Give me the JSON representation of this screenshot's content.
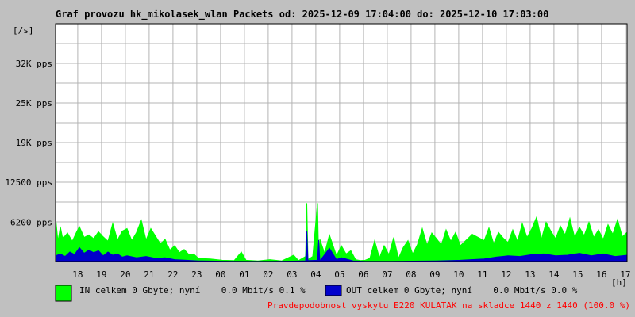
{
  "colors": {
    "background": "#c0c0c0",
    "plot_background": "#ffffff",
    "grid": "#b4b4b4",
    "in_series": "#00ff00",
    "out_series": "#0000cc",
    "info_text": "#ff0000"
  },
  "legend": {
    "in_text": "IN celkem 0 Gbyte; nyní    0.0 Mbit/s 0.1 %",
    "out_text": "OUT celkem 0 Gbyte; nyní    0.0 Mbit/s 0.0 %"
  },
  "footer": {
    "info": "Pravdepodobnost vyskytu E220 KULATAK na skladce 1440 z 1440 (100.0 %)"
  },
  "chart_data": {
    "type": "area",
    "title": "Graf provozu hk_mikolasek_wlan Packets od: 2025-12-09 17:04:00 do: 2025-12-10 17:03:00",
    "ylabel": "[/s]",
    "xlabel": "[h]",
    "grid": true,
    "ylim": [
      0,
      37500
    ],
    "xlim": [
      0,
      24
    ],
    "y_ticks": [
      {
        "value": 6200,
        "label": "6200 pps"
      },
      {
        "value": 12500,
        "label": "12500 pps"
      },
      {
        "value": 18750,
        "label": "19K pps"
      },
      {
        "value": 25000,
        "label": "25K pps"
      },
      {
        "value": 31250,
        "label": "32K pps"
      }
    ],
    "x_ticks": [
      "18",
      "19",
      "20",
      "21",
      "22",
      "23",
      "00",
      "01",
      "02",
      "03",
      "04",
      "05",
      "06",
      "07",
      "08",
      "09",
      "10",
      "11",
      "12",
      "13",
      "14",
      "15",
      "16",
      "17"
    ],
    "x_start_hour": 17.07,
    "series": [
      {
        "name": "IN",
        "x": [
          0.0,
          0.1,
          0.2,
          0.3,
          0.5,
          0.7,
          0.9,
          1.0,
          1.2,
          1.4,
          1.6,
          1.8,
          2.0,
          2.2,
          2.4,
          2.6,
          2.8,
          3.0,
          3.2,
          3.4,
          3.6,
          3.8,
          4.0,
          4.2,
          4.4,
          4.6,
          4.8,
          5.0,
          5.2,
          5.4,
          5.6,
          5.8,
          6.0,
          6.5,
          7.0,
          7.5,
          7.8,
          8.0,
          8.5,
          9.0,
          9.5,
          10.0,
          10.2,
          10.5,
          10.55,
          10.6,
          10.8,
          11.0,
          11.05,
          11.1,
          11.3,
          11.5,
          11.8,
          12.0,
          12.2,
          12.4,
          12.6,
          12.8,
          13.0,
          13.2,
          13.4,
          13.6,
          13.8,
          14.0,
          14.2,
          14.4,
          14.6,
          14.8,
          15.0,
          15.2,
          15.4,
          15.6,
          15.8,
          16.0,
          16.2,
          16.4,
          16.6,
          16.8,
          17.0,
          17.5,
          18.0,
          18.2,
          18.4,
          18.6,
          18.8,
          19.0,
          19.2,
          19.4,
          19.6,
          19.8,
          20.0,
          20.2,
          20.4,
          20.6,
          20.8,
          21.0,
          21.2,
          21.4,
          21.6,
          21.8,
          22.0,
          22.2,
          22.4,
          22.6,
          22.8,
          23.0,
          23.2,
          23.4,
          23.6,
          23.8,
          24.0
        ],
        "values": [
          7000,
          3200,
          5500,
          3600,
          4500,
          3200,
          4800,
          5500,
          3800,
          4200,
          3600,
          4700,
          3900,
          3200,
          6000,
          3400,
          4800,
          5200,
          3300,
          4600,
          6500,
          3400,
          5200,
          4000,
          2800,
          3500,
          1800,
          2500,
          1400,
          1900,
          1100,
          1200,
          500,
          400,
          200,
          150,
          1500,
          200,
          100,
          300,
          100,
          1000,
          150,
          800,
          9200,
          300,
          800,
          9200,
          300,
          3500,
          1300,
          4200,
          900,
          2500,
          1200,
          1700,
          300,
          150,
          200,
          500,
          3300,
          600,
          2500,
          1100,
          3800,
          500,
          2200,
          3300,
          1200,
          2700,
          5200,
          2600,
          4500,
          3600,
          2600,
          5000,
          3200,
          4600,
          2500,
          4300,
          3300,
          5300,
          2800,
          4600,
          3700,
          3000,
          5000,
          3200,
          6000,
          3800,
          5200,
          7000,
          3500,
          6200,
          4800,
          3600,
          5600,
          4200,
          6800,
          3800,
          5400,
          4100,
          6200,
          3800,
          5000,
          3500,
          5800,
          4300,
          6600,
          3900,
          4600
        ]
      },
      {
        "name": "OUT",
        "x": [
          0.0,
          0.2,
          0.4,
          0.6,
          0.8,
          1.0,
          1.2,
          1.4,
          1.6,
          1.8,
          2.0,
          2.2,
          2.4,
          2.6,
          2.8,
          3.0,
          3.4,
          3.8,
          4.2,
          4.6,
          5.0,
          5.5,
          6.0,
          7.0,
          8.0,
          9.0,
          10.0,
          10.5,
          10.55,
          10.6,
          11.0,
          11.05,
          11.1,
          11.5,
          11.8,
          12.0,
          12.5,
          13.0,
          14.0,
          15.0,
          16.0,
          17.0,
          18.0,
          18.5,
          19.0,
          19.5,
          20.0,
          20.5,
          21.0,
          21.5,
          22.0,
          22.5,
          23.0,
          23.5,
          24.0
        ],
        "values": [
          900,
          1200,
          800,
          1500,
          1100,
          2200,
          1300,
          1800,
          1400,
          1700,
          900,
          1500,
          1000,
          1200,
          700,
          900,
          600,
          800,
          500,
          600,
          300,
          200,
          100,
          50,
          30,
          40,
          60,
          100,
          4800,
          150,
          200,
          3400,
          100,
          2100,
          300,
          600,
          100,
          40,
          30,
          60,
          100,
          200,
          400,
          700,
          900,
          800,
          1100,
          1200,
          900,
          1000,
          1300,
          900,
          1200,
          800,
          1000
        ]
      }
    ]
  }
}
